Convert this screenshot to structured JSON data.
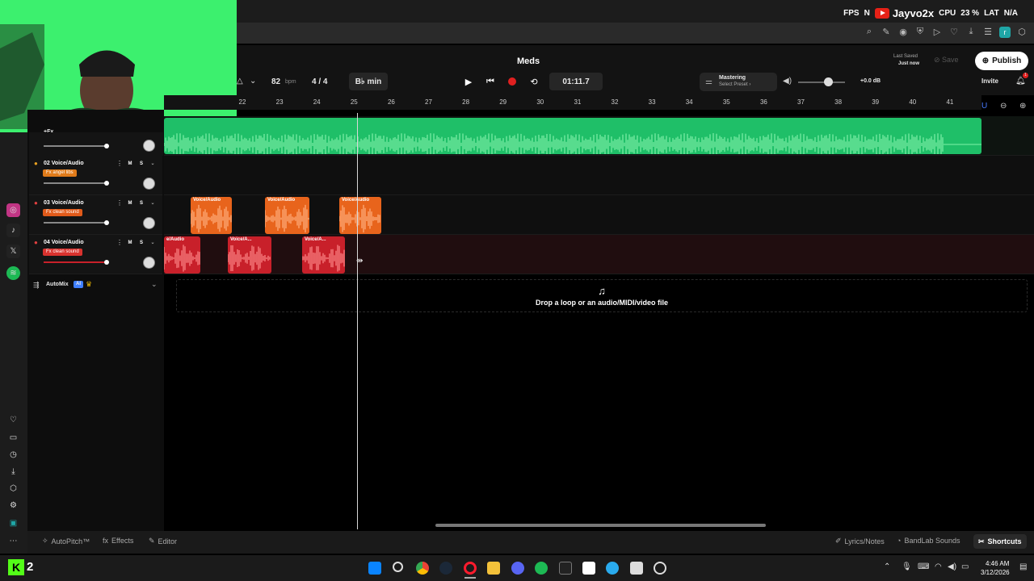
{
  "overlay": {
    "fps_label": "FPS",
    "fps_value": "N",
    "channel": "Jayvo2x",
    "cpu_label": "CPU",
    "cpu_value": "23 %",
    "lat_label": "LAT",
    "lat_value": "N/A"
  },
  "extension_icons": [
    "search-icon",
    "edit-icon",
    "camera-icon",
    "shield-icon",
    "play-icon",
    "heart-icon",
    "download-icon",
    "menu-icon",
    "r",
    "extension-icon"
  ],
  "extension_badge": "r",
  "project": {
    "title": "Meds",
    "bpm": "82",
    "bpm_unit": "bpm",
    "time_signature": "4 / 4",
    "key": "B♭ min",
    "time": "01:11.7",
    "mastering_label": "Mastering",
    "mastering_preset": "Select Preset ›",
    "master_volume": "+0.0 dB",
    "last_saved_label": "Last Saved",
    "last_saved_value": "Just now",
    "save_label": "Save",
    "publish_label": "Publish",
    "invite_label": "Invite",
    "notification_count": "1"
  },
  "ruler": [
    "22",
    "23",
    "24",
    "25",
    "26",
    "27",
    "28",
    "29",
    "30",
    "31",
    "32",
    "33",
    "34",
    "35",
    "36",
    "37",
    "38",
    "39",
    "40",
    "41"
  ],
  "tracks": [
    {
      "name": "+Fx",
      "fx": ""
    },
    {
      "name": "02  Voice/Audio",
      "fx": "Fx  angel libs",
      "fx_color": "#e07b1a"
    },
    {
      "name": "03  Voice/Audio",
      "fx": "Fx  clean sound",
      "fx_color": "#e05a1a"
    },
    {
      "name": "04  Voice/Audio",
      "fx": "Fx  clean sound",
      "fx_color": "#d8322e"
    }
  ],
  "track_buttons": {
    "mute": "M",
    "solo": "S"
  },
  "clips": {
    "track3": [
      "Voice/Audio",
      "Voice/Audio",
      "Voice/Audio"
    ],
    "track4": [
      "e/Audio",
      "Voice/A...",
      "Voice/A..."
    ]
  },
  "automix": {
    "label": "AutoMix",
    "badge": "AI"
  },
  "drop_zone_text": "Drop a loop or an audio/MIDI/video file",
  "bottom_bar": {
    "autopitch": "AutoPitch™",
    "effects": "Effects",
    "editor": "Editor",
    "lyrics": "Lyrics/Notes",
    "sounds": "BandLab Sounds",
    "shortcuts": "Shortcuts"
  },
  "taskbar": {
    "app_badge": "2",
    "time": "4:46 AM",
    "date": "3/12/2026"
  },
  "colors": {
    "track1": "#1fbf68",
    "track3": "#e8641c",
    "track4": "#c8202a",
    "accent_red": "#e02020"
  }
}
